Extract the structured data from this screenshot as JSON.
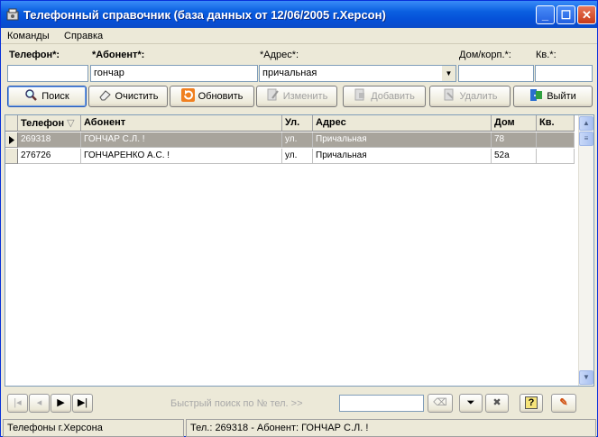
{
  "window": {
    "title": "Телефонный справочник (база данных от 12/06/2005 г.Херсон)"
  },
  "menu": {
    "items": [
      "Команды",
      "Справка"
    ]
  },
  "form": {
    "phone_label": "Телефон*:",
    "abonent_label": "*Абонент*:",
    "address_label": "*Адрес*:",
    "house_label": "Дом/корп.*:",
    "apt_label": "Кв.*:",
    "phone_value": "",
    "abonent_value": "гончар",
    "address_value": "причальная",
    "house_value": "",
    "apt_value": ""
  },
  "toolbar": {
    "search": "Поиск",
    "clear": "Очистить",
    "refresh": "Обновить",
    "edit": "Изменить",
    "add": "Добавить",
    "delete": "Удалить",
    "exit": "Выйти"
  },
  "table": {
    "columns": [
      "Телефон",
      "Абонент",
      "Ул.",
      "Адрес",
      "Дом",
      "Кв."
    ],
    "sort_glyph": "▽",
    "rows": [
      [
        "269318",
        "ГОНЧАР С.Л. !",
        "ул.",
        "Причальная",
        "78",
        ""
      ],
      [
        "276726",
        "ГОНЧАРЕНКО А.С. !",
        "ул.",
        "Причальная",
        "52а",
        ""
      ]
    ]
  },
  "navbar": {
    "quick_search_label": "Быстрый поиск по № тел. >>",
    "quick_search_value": ""
  },
  "status": {
    "left": "Телефоны г.Херсона",
    "right": "Тел.: 269318 - Абонент: ГОНЧАР С.Л. !"
  }
}
